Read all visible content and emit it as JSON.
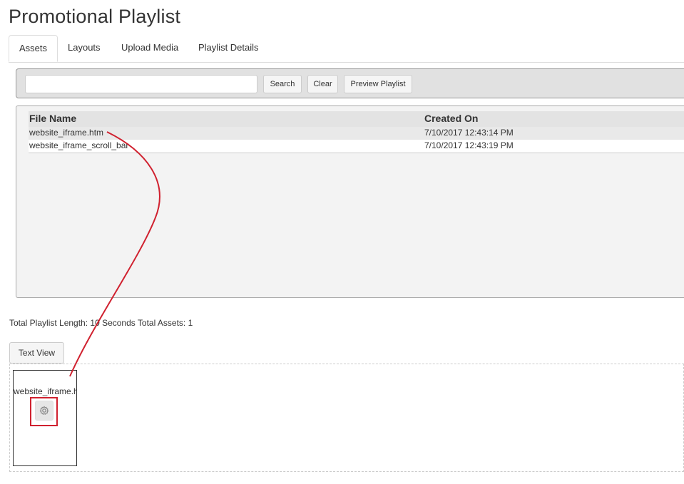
{
  "page": {
    "title": "Promotional Playlist"
  },
  "tabs": [
    {
      "label": "Assets",
      "active": true
    },
    {
      "label": "Layouts",
      "active": false
    },
    {
      "label": "Upload Media",
      "active": false
    },
    {
      "label": "Playlist Details",
      "active": false
    }
  ],
  "search": {
    "value": "",
    "placeholder": "",
    "search_label": "Search",
    "clear_label": "Clear",
    "preview_label": "Preview Playlist"
  },
  "assets_table": {
    "columns": [
      "File Name",
      "Created On"
    ],
    "rows": [
      {
        "file_name": "website_iframe.htm",
        "created_on": "7/10/2017 12:43:14 PM"
      },
      {
        "file_name": "website_iframe_scroll_bar",
        "created_on": "7/10/2017 12:43:19 PM"
      }
    ]
  },
  "summary": {
    "text": "Total Playlist Length: 10 Seconds Total Assets: 1"
  },
  "timeline": {
    "text_view_label": "Text View",
    "card_label": "website_iframe.htm"
  },
  "colors": {
    "annotation": "#d0212f",
    "panel_bg": "#e1e1e1",
    "table_bg": "#f3f3f3"
  },
  "icons": {
    "settings": "gear-icon"
  }
}
